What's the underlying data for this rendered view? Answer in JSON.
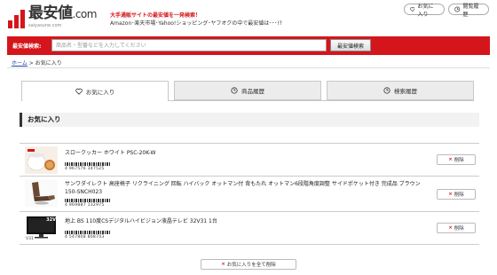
{
  "header": {
    "logo_main": "最安値",
    "logo_dotcom": ".com",
    "logo_sub": "saiyasune.com",
    "catch_line1": "大手通販サイトの最安値を一発検索！",
    "catch_line2": "Amazon･楽天市場･Yahoo!ショッピング･ヤフオクの中で最安値は･･･!?",
    "fav_button": "お気に入り",
    "history_button": "閲覧履歴"
  },
  "search": {
    "label": "最安値検索:",
    "placeholder": "商品名・型番などを入力してください",
    "value": "",
    "button": "最安値検索"
  },
  "breadcrumb": {
    "home": "ホーム",
    "separator": ">",
    "current": "お気に入り"
  },
  "tabs": [
    {
      "label": "お気に入り",
      "icon": "heart-icon",
      "active": true
    },
    {
      "label": "商品履歴",
      "icon": "clock-icon",
      "active": false
    },
    {
      "label": "検索履歴",
      "icon": "clock-icon",
      "active": false
    }
  ],
  "section_title": "お気に入り",
  "items": [
    {
      "name": "スロークッカー ホワイト PSC-20K-W",
      "jan": "4 967576 347525",
      "delete": "削除"
    },
    {
      "name": "サンワダイレクト 高座椅子 リクライニング 回転 ハイバック オットマン付 背もたれ オットマン6段階角度調整 サイドポケット付き 完成品 ブラウン 150-SNCH023",
      "jan": "4 969887 132975",
      "delete": "削除"
    },
    {
      "name": "地上 BS 110度CSデジタルハイビジョン液晶テレビ 32V31 1台",
      "jan": "4 547808 808743",
      "delete": "削除",
      "thumb_label": "32V",
      "thumb_model": "V31"
    }
  ],
  "delete_all": "お気に入りを全て削除",
  "colors": {
    "brand": "#d4161c"
  }
}
